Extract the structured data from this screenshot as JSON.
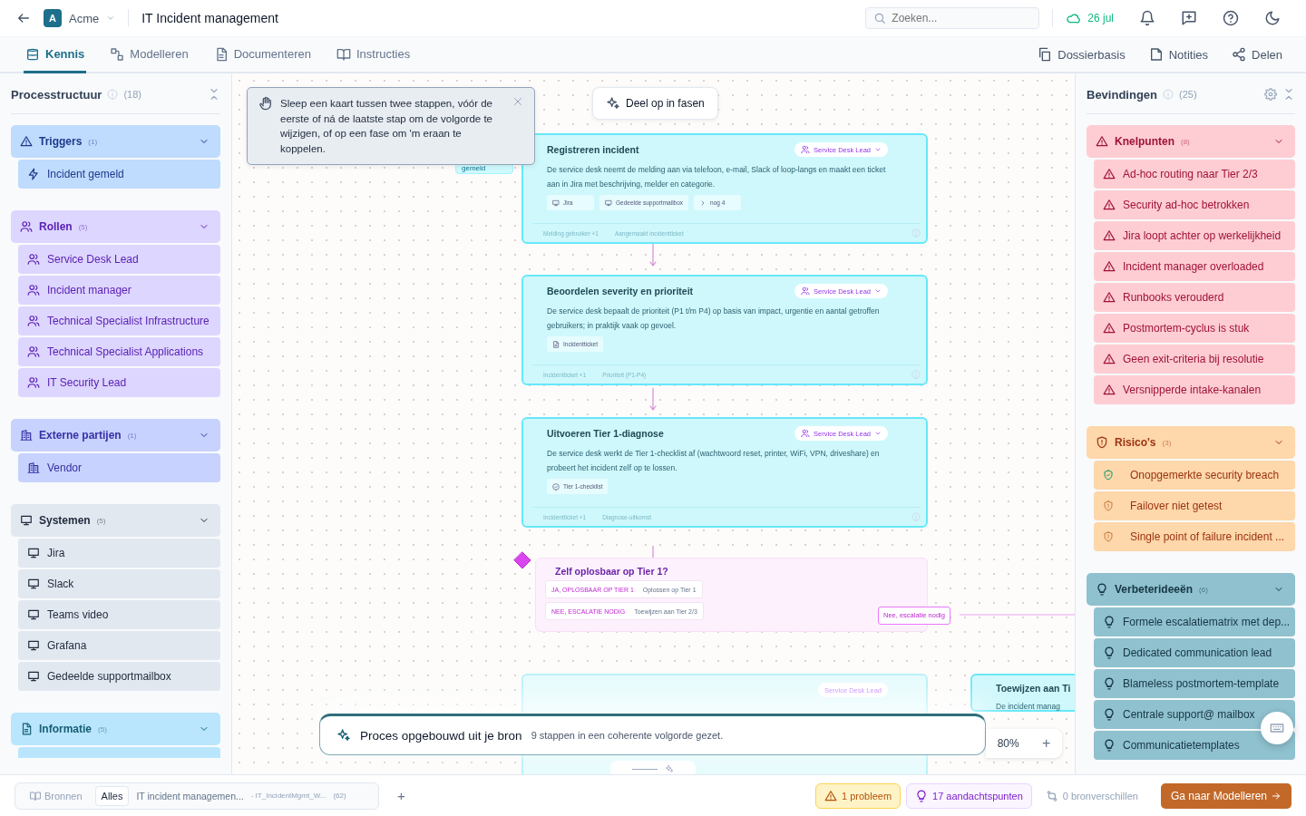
{
  "header": {
    "org_initial": "A",
    "org": "Acme",
    "title": "IT Incident management",
    "search": {
      "placeholder": "Zoeken..."
    },
    "sync_date": "26 jul"
  },
  "tabs": [
    {
      "label": "Kennis",
      "selected": true
    },
    {
      "label": "Modelleren",
      "selected": false
    },
    {
      "label": "Documenteren",
      "selected": false
    },
    {
      "label": "Instructies",
      "selected": false
    }
  ],
  "actions": [
    {
      "label": "Dossierbasis"
    },
    {
      "label": "Notities"
    },
    {
      "label": "Delen"
    }
  ],
  "structure": {
    "title": "Processtructuur",
    "count": "(18)",
    "groups": [
      {
        "kind": "trigger",
        "label": "Triggers",
        "count": "(1)",
        "items": [
          "Incident gemeld"
        ]
      },
      {
        "kind": "role",
        "label": "Rollen",
        "count": "(5)",
        "items": [
          "Service Desk Lead",
          "Incident manager",
          "Technical Specialist Infrastructure",
          "Technical Specialist Applications",
          "IT Security Lead"
        ]
      },
      {
        "kind": "party",
        "label": "Externe partijen",
        "count": "(1)",
        "items": [
          "Vendor"
        ]
      },
      {
        "kind": "system",
        "label": "Systemen",
        "count": "(5)",
        "items": [
          "Jira",
          "Slack",
          "Teams video",
          "Grafana",
          "Gedeelde supportmailbox"
        ]
      },
      {
        "kind": "info",
        "label": "Informatie",
        "count": "(5)"
      }
    ]
  },
  "canvas": {
    "hint": "Sleep een kaart tussen twee stappen, vóór de eerste of ná de laatste stap om de volgorde te wijzigen, of op een fase om 'm eraan te koppelen.",
    "split_button": "Deel op in fasen",
    "trigger_node": "gemeld",
    "steps": [
      {
        "title": "Registreren incident",
        "role": "Service Desk Lead",
        "description": "De service desk neemt de melding aan via telefoon, e-mail, Slack of loop-langs en maakt een ticket aan in Jira met beschrijving, melder en categorie.",
        "chips": [
          {
            "kind": "system",
            "label": "Jira"
          },
          {
            "kind": "system",
            "label": "Gedeelde supportmailbox"
          },
          {
            "kind": "more",
            "label": "nog 4"
          }
        ],
        "input": "Melding gebruiker +1",
        "output": "Aangemaakt incidentticket"
      },
      {
        "title": "Beoordelen severity en prioriteit",
        "role": "Service Desk Lead",
        "description": "De service desk bepaalt de prioriteit (P1 t/m P4) op basis van impact, urgentie en aantal getroffen gebruikers; in praktijk vaak op gevoel.",
        "chips": [
          {
            "kind": "info",
            "label": "Incidentticket"
          }
        ],
        "input": "Incidentticket +1",
        "output": "Prioriteit (P1-P4)"
      },
      {
        "title": "Uitvoeren Tier 1-diagnose",
        "role": "Service Desk Lead",
        "description": "De service desk werkt de Tier 1-checklist af (wachtwoord reset, printer, WiFi, VPN, driveshare) en probeert het incident zelf op te lossen.",
        "chips": [
          {
            "kind": "check",
            "label": "Tier 1-checklist"
          }
        ],
        "input": "Incidentticket +1",
        "output": "Diagnose-uitkomst"
      }
    ],
    "decision": {
      "title": "Zelf oplosbaar op Tier 1?",
      "options": [
        {
          "answer": "JA, OPLOSBAAR OP TIER 1",
          "target": "Oplossen op Tier 1"
        },
        {
          "answer": "NEE, ESCALATIE NODIG",
          "target": "Toewijzen aan Tier 2/3"
        }
      ],
      "branch_label": "Nee, escalatie nodig"
    },
    "faded_card": {
      "role": "Service Desk Lead"
    },
    "side_card": {
      "title": "Toewijzen aan Ti",
      "description": "De incident manag"
    },
    "banner": {
      "title": "Proces opgebouwd uit je bron",
      "text": "9 stappen in een coherente volgorde gezet."
    },
    "zoom": {
      "value": "80%",
      "plus": "+"
    }
  },
  "findings": {
    "title": "Bevindingen",
    "count": "(25)",
    "groups": [
      {
        "kind": "problem",
        "label": "Knelpunten",
        "count": "(8)",
        "items": [
          {
            "label": "Ad-hoc routing naar Tier 2/3"
          },
          {
            "label": "Security ad-hoc betrokken"
          },
          {
            "label": "Jira loopt achter op werkelijkheid"
          },
          {
            "label": "Incident manager overloaded"
          },
          {
            "label": "Runbooks verouderd"
          },
          {
            "label": "Postmortem-cyclus is stuk"
          },
          {
            "label": "Geen exit-criteria bij resolutie"
          },
          {
            "label": "Versnipperde intake-kanalen"
          }
        ]
      },
      {
        "kind": "risk",
        "label": "Risico's",
        "count": "(3)",
        "items": [
          {
            "label": "Onopgemerkte security breach",
            "mitigated": true
          },
          {
            "label": "Failover niet getest",
            "mitigated": false
          },
          {
            "label": "Single point of failure incident ...",
            "mitigated": false
          }
        ]
      },
      {
        "kind": "idea",
        "label": "Verbeterideeën",
        "count": "(6)",
        "items": [
          {
            "label": "Formele escalatiematrix met dep..."
          },
          {
            "label": "Dedicated communication lead"
          },
          {
            "label": "Blameless postmortem-template"
          },
          {
            "label": "Centrale support@ mailbox"
          },
          {
            "label": "Communicatietemplates"
          }
        ]
      }
    ]
  },
  "footer": {
    "filters": [
      {
        "label": "Bronnen",
        "selected": false
      },
      {
        "label": "Alles",
        "selected": true
      }
    ],
    "source": "IT incident managemen...",
    "file": "- IT_IncidentMgmt_W...",
    "file_count": "(62)",
    "add": "+",
    "status": [
      {
        "kind": "problem",
        "label": "1 probleem"
      },
      {
        "kind": "attention",
        "label": "17 aandachtspunten"
      },
      {
        "kind": "diff",
        "label": "0 bronverschillen"
      }
    ],
    "next_button": "Ga naar Modelleren"
  }
}
